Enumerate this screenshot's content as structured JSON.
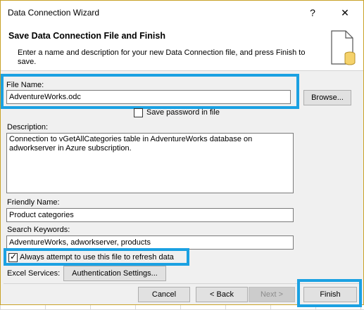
{
  "window": {
    "title": "Data Connection Wizard",
    "help_glyph": "?",
    "close_glyph": "✕"
  },
  "header": {
    "title": "Save Data Connection File and Finish",
    "description": "Enter a name and description for your new Data Connection file, and press Finish to save."
  },
  "file_name": {
    "label": "File Name:",
    "value": "AdventureWorks.odc",
    "browse_label": "Browse..."
  },
  "save_password": {
    "label": "Save password in file",
    "checked": false
  },
  "description": {
    "label": "Description:",
    "value": "Connection to vGetAllCategories table in AdventureWorks database on adworkserver in Azure subscription."
  },
  "friendly_name": {
    "label": "Friendly Name:",
    "value": "Product categories"
  },
  "search_keywords": {
    "label": "Search Keywords:",
    "value": "AdventureWorks, adworkserver, products"
  },
  "always_refresh": {
    "label": "Always attempt to use this file to refresh data",
    "checked": true
  },
  "excel_services": {
    "label": "Excel Services:",
    "auth_button_label": "Authentication Settings..."
  },
  "footer": {
    "cancel_label": "Cancel",
    "back_label": "< Back",
    "next_label": "Next >",
    "finish_label": "Finish"
  },
  "colors": {
    "highlight": "#1ba1e2",
    "dialog_bg": "#f0f0f0",
    "border_gold": "#c9a227"
  },
  "icons": {
    "header_icon": "data-connection-file-icon"
  }
}
